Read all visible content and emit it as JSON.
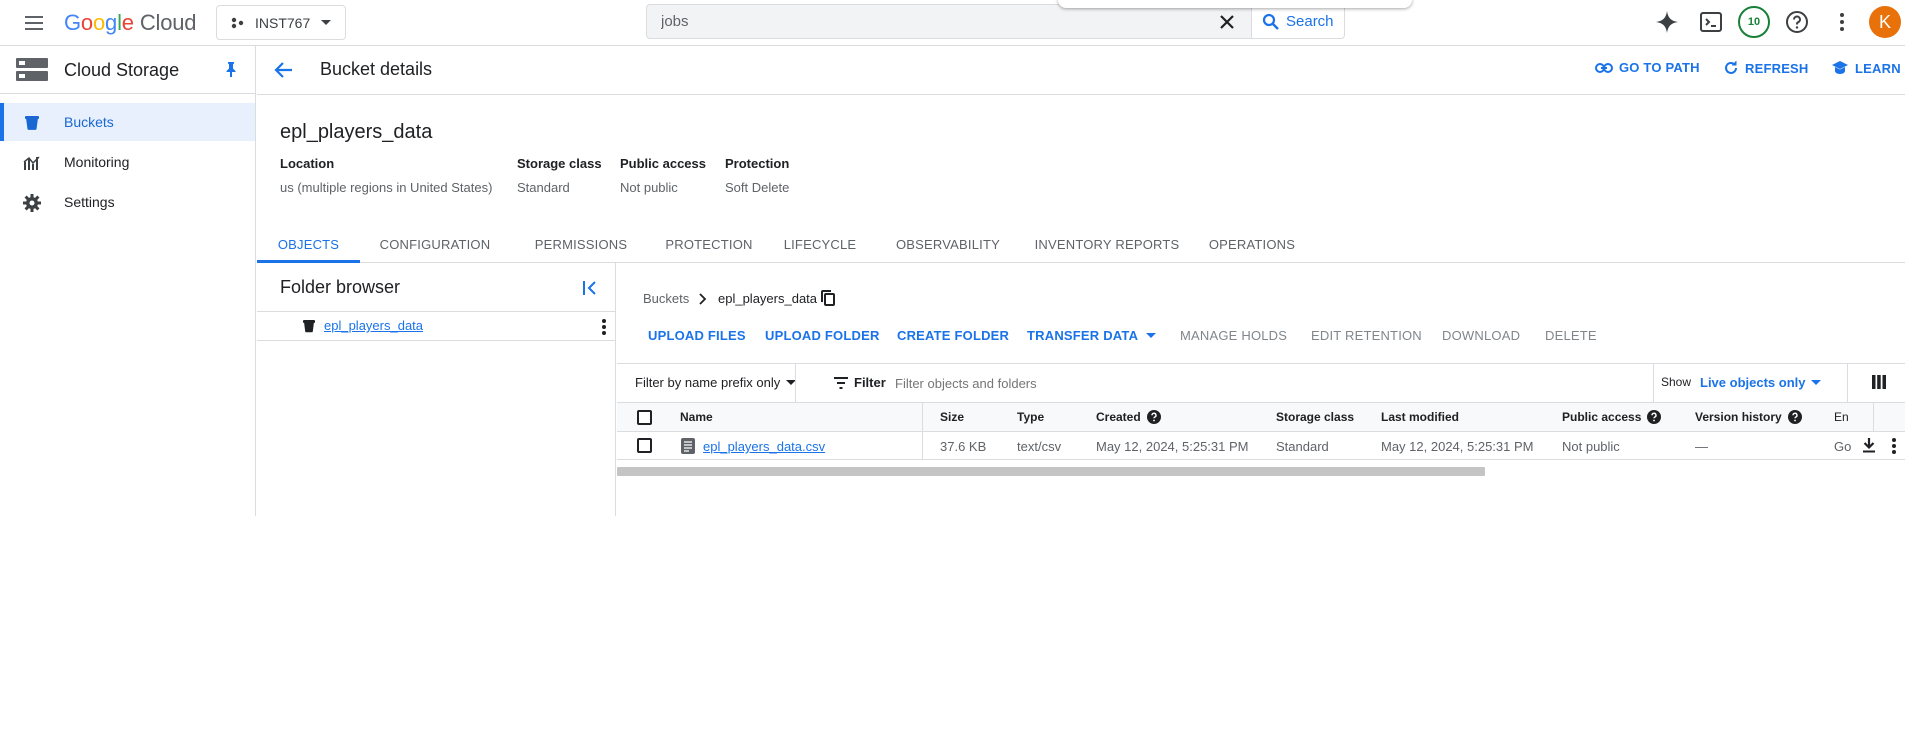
{
  "topbar": {
    "logo": {
      "G": "G",
      "o1": "o",
      "o2": "o",
      "g": "g",
      "l": "l",
      "e": "e",
      "cloud": "Cloud"
    },
    "project": "INST767",
    "search_value": "jobs",
    "search_button": "Search",
    "notifications_count": "10",
    "avatar_letter": "K",
    "icons": [
      "menu-icon",
      "project-icon",
      "dropdown-icon",
      "clear-icon",
      "search-icon",
      "gemini-icon",
      "terminal-icon",
      "help-icon",
      "more-vert-icon"
    ]
  },
  "sidebar": {
    "title": "Cloud Storage",
    "items": [
      {
        "label": "Buckets",
        "icon": "bucket-icon",
        "active": true
      },
      {
        "label": "Monitoring",
        "icon": "monitoring-icon",
        "active": false
      },
      {
        "label": "Settings",
        "icon": "gear-icon",
        "active": false
      }
    ]
  },
  "header": {
    "title": "Bucket details",
    "actions": [
      "GO TO PATH",
      "REFRESH",
      "LEARN"
    ]
  },
  "bucket": {
    "name": "epl_players_data",
    "meta": [
      {
        "label": "Location",
        "value": "us (multiple regions in United States)"
      },
      {
        "label": "Storage class",
        "value": "Standard"
      },
      {
        "label": "Public access",
        "value": "Not public"
      },
      {
        "label": "Protection",
        "value": "Soft Delete"
      }
    ]
  },
  "tabs": [
    "OBJECTS",
    "CONFIGURATION",
    "PERMISSIONS",
    "PROTECTION",
    "LIFECYCLE",
    "OBSERVABILITY",
    "INVENTORY REPORTS",
    "OPERATIONS"
  ],
  "folder_browser": {
    "title": "Folder browser",
    "item": "epl_players_data"
  },
  "breadcrumb": {
    "root": "Buckets",
    "current": "epl_players_data"
  },
  "object_actions": [
    {
      "label": "UPLOAD FILES",
      "enabled": true
    },
    {
      "label": "UPLOAD FOLDER",
      "enabled": true
    },
    {
      "label": "CREATE FOLDER",
      "enabled": true
    },
    {
      "label": "TRANSFER DATA",
      "enabled": true
    },
    {
      "label": "MANAGE HOLDS",
      "enabled": false
    },
    {
      "label": "EDIT RETENTION",
      "enabled": false
    },
    {
      "label": "DOWNLOAD",
      "enabled": false
    },
    {
      "label": "DELETE",
      "enabled": false
    }
  ],
  "filter_bar": {
    "prefix_select": "Filter by name prefix only",
    "filter_label": "Filter",
    "placeholder": "Filter objects and folders",
    "show_label": "Show",
    "show_value": "Live objects only"
  },
  "table": {
    "columns": [
      "Name",
      "Size",
      "Type",
      "Created",
      "Storage class",
      "Last modified",
      "Public access",
      "Version history",
      "En"
    ],
    "rows": [
      {
        "name": "epl_players_data.csv",
        "size": "37.6 KB",
        "type": "text/csv",
        "created": "May 12, 2024, 5:25:31 PM",
        "storage_class": "Standard",
        "last_modified": "May 12, 2024, 5:25:31 PM",
        "public_access": "Not public",
        "version_history": "—",
        "encryption": "Go"
      }
    ]
  },
  "colors": {
    "accent": "#1a73e8",
    "active_bg": "#e8f0fe",
    "border": "#dadce0",
    "avatar": "#e8710a",
    "badge": "#188038"
  }
}
